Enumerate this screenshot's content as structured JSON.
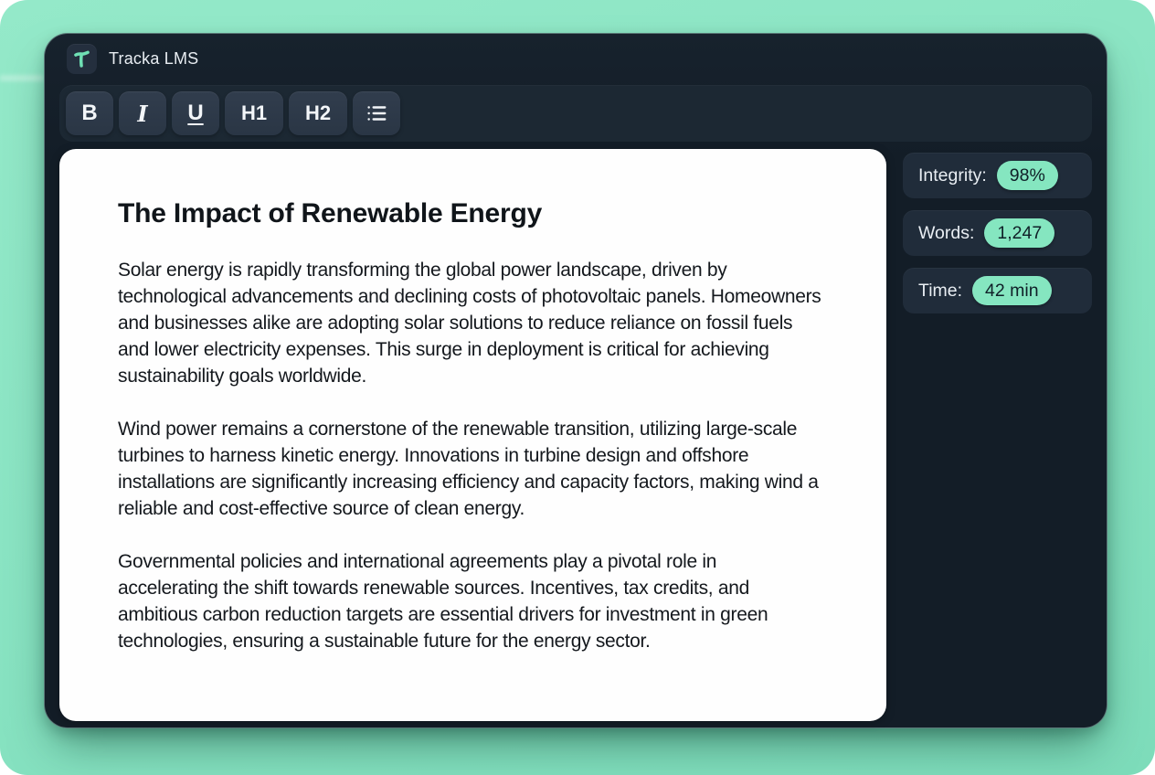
{
  "window": {
    "title": "Tracka LMS"
  },
  "branding": {
    "logo_icon": "tracka-logo-icon"
  },
  "toolbar": {
    "buttons": [
      {
        "id": "bold",
        "label": "B"
      },
      {
        "id": "italic",
        "label": "I"
      },
      {
        "id": "underline",
        "label": "U"
      },
      {
        "id": "heading1",
        "label": "H1"
      },
      {
        "id": "heading2",
        "label": "H2"
      },
      {
        "id": "bullet-list",
        "icon": "bullet-list-icon"
      }
    ]
  },
  "document": {
    "title": "The Impact of Renewable Energy",
    "paragraphs": [
      "Solar energy is rapidly transforming the global power landscape, driven by technological advancements and declining costs of photovoltaic panels. Homeowners and businesses alike are adopting solar solutions to reduce reliance on fossil fuels and lower electricity expenses. This surge in deployment is critical for achieving sustainability goals worldwide.",
      "Wind power remains a cornerstone of the renewable transition, utilizing large-scale turbines to harness kinetic energy. Innovations in turbine design and offshore installations are significantly increasing efficiency and capacity factors, making wind a reliable and cost-effective source of clean energy.",
      "Governmental policies and international agreements play a pivotal role in accelerating the shift towards renewable sources. Incentives, tax credits, and ambitious carbon reduction targets are essential drivers for investment in green technologies, ensuring a sustainable future for the energy sector."
    ]
  },
  "stats": [
    {
      "label": "Integrity:",
      "value": "98%"
    },
    {
      "label": "Words:",
      "value": "1,247"
    },
    {
      "label": "Time:",
      "value": "42 min"
    }
  ],
  "colors": {
    "background_mint": "#8BE4C3",
    "window_bg": "#131D27",
    "toolbar_panel_bg": "#1C2833",
    "button_bg": "#2C3847",
    "stat_card_bg": "#202C3A",
    "accent_mint": "#85E6C0",
    "pill_text": "#102028",
    "document_bg": "#FEFEFE",
    "title_text": "#E8EDF2"
  }
}
